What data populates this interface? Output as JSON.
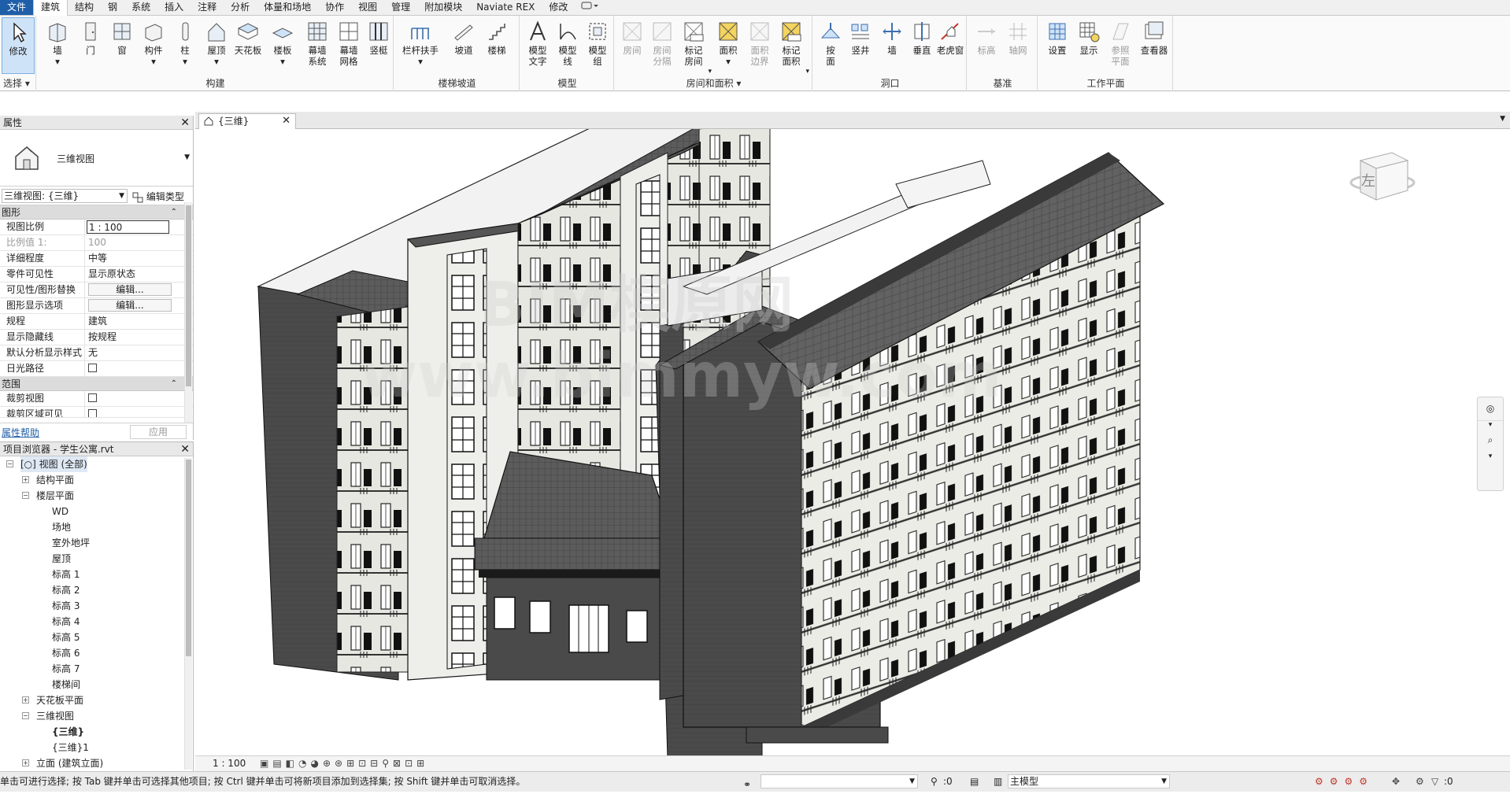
{
  "ribbon_tabs": [
    "文件",
    "建筑",
    "结构",
    "钢",
    "系统",
    "插入",
    "注释",
    "分析",
    "体量和场地",
    "协作",
    "视图",
    "管理",
    "附加模块",
    "Naviate REX",
    "修改"
  ],
  "active_tab": "建筑",
  "ribbon": {
    "select": {
      "tool": "修改",
      "group": "选择"
    },
    "build": {
      "group": "构建",
      "buttons": [
        "墙",
        "门",
        "窗",
        "构件",
        "柱",
        "屋顶",
        "天花板",
        "楼板",
        "幕墙\n系统",
        "幕墙\n网格",
        "竖梃"
      ]
    },
    "stairs": {
      "group": "楼梯坡道",
      "buttons": [
        "栏杆扶手",
        "坡道",
        "楼梯"
      ]
    },
    "model": {
      "group": "模型",
      "buttons": [
        "模型\n文字",
        "模型\n线",
        "模型\n组"
      ]
    },
    "rooms": {
      "group": "房间和面积",
      "buttons": [
        "房间",
        "房间\n分隔",
        "标记\n房间",
        "面积",
        "面积\n边界",
        "标记\n面积"
      ]
    },
    "opening": {
      "group": "洞口",
      "buttons": [
        "按\n面",
        "竖井",
        "墙",
        "垂直",
        "老虎窗"
      ]
    },
    "datum": {
      "group": "基准",
      "buttons": [
        "标高",
        "轴网"
      ]
    },
    "workplane": {
      "group": "工作平面",
      "buttons": [
        "设置",
        "显示",
        "参照\n平面",
        "查看器"
      ]
    }
  },
  "properties": {
    "title": "属性",
    "type_name": "三维视图",
    "view_selector": "三维视图: {三维}",
    "edit_type": "编辑类型",
    "sections": [
      {
        "name": "图形",
        "rows": [
          {
            "k": "视图比例",
            "v": "1 : 100",
            "kind": "input"
          },
          {
            "k": "比例值 1:",
            "v": "100",
            "kind": "dim"
          },
          {
            "k": "详细程度",
            "v": "中等"
          },
          {
            "k": "零件可见性",
            "v": "显示原状态"
          },
          {
            "k": "可见性/图形替换",
            "v": "编辑...",
            "kind": "button"
          },
          {
            "k": "图形显示选项",
            "v": "编辑...",
            "kind": "button"
          },
          {
            "k": "规程",
            "v": "建筑"
          },
          {
            "k": "显示隐藏线",
            "v": "按规程"
          },
          {
            "k": "默认分析显示样式",
            "v": "无"
          },
          {
            "k": "日光路径",
            "v": "",
            "kind": "check"
          }
        ]
      },
      {
        "name": "范围",
        "rows": [
          {
            "k": "裁剪视图",
            "v": "",
            "kind": "check"
          },
          {
            "k": "裁剪区域可见",
            "v": "",
            "kind": "check"
          }
        ]
      }
    ],
    "help_link": "属性帮助",
    "apply": "应用"
  },
  "browser": {
    "title": "项目浏览器 - 学生公寓.rvt",
    "items": [
      {
        "label": "视图 (全部)",
        "level": 0,
        "exp": "−"
      },
      {
        "label": "结构平面",
        "level": 1,
        "exp": "+"
      },
      {
        "label": "楼层平面",
        "level": 1,
        "exp": "−"
      },
      {
        "label": "WD",
        "level": 2
      },
      {
        "label": "场地",
        "level": 2
      },
      {
        "label": "室外地坪",
        "level": 2
      },
      {
        "label": "屋顶",
        "level": 2
      },
      {
        "label": "标高 1",
        "level": 2
      },
      {
        "label": "标高 2",
        "level": 2
      },
      {
        "label": "标高 3",
        "level": 2
      },
      {
        "label": "标高 4",
        "level": 2
      },
      {
        "label": "标高 5",
        "level": 2
      },
      {
        "label": "标高 6",
        "level": 2
      },
      {
        "label": "标高 7",
        "level": 2
      },
      {
        "label": "楼梯间",
        "level": 2
      },
      {
        "label": "天花板平面",
        "level": 1,
        "exp": "+"
      },
      {
        "label": "三维视图",
        "level": 1,
        "exp": "−"
      },
      {
        "label": "{三维}",
        "level": 2,
        "bold": true
      },
      {
        "label": "{三维}1",
        "level": 2
      },
      {
        "label": "立面 (建筑立面)",
        "level": 1,
        "exp": "+"
      }
    ]
  },
  "view_tab": "{三维}",
  "viewcube_face": "左",
  "watermark": "BIM模原网 www.bimmyw.com",
  "view_bar_scale": "1 : 100",
  "status": {
    "message": "单击可进行选择; 按 Tab 键并单击可选择其他项目; 按 Ctrl 键并单击可将新项目添加到选择集; 按 Shift 键并单击可取消选择。",
    "count": ":0",
    "model_combo": "主模型",
    "filter_count": ":0"
  },
  "colors": {
    "file_tab": "#1f5ea8",
    "selection": "#cfe3f8",
    "building_dark": "#4a4a4a",
    "building_light": "#e6e6e0"
  }
}
